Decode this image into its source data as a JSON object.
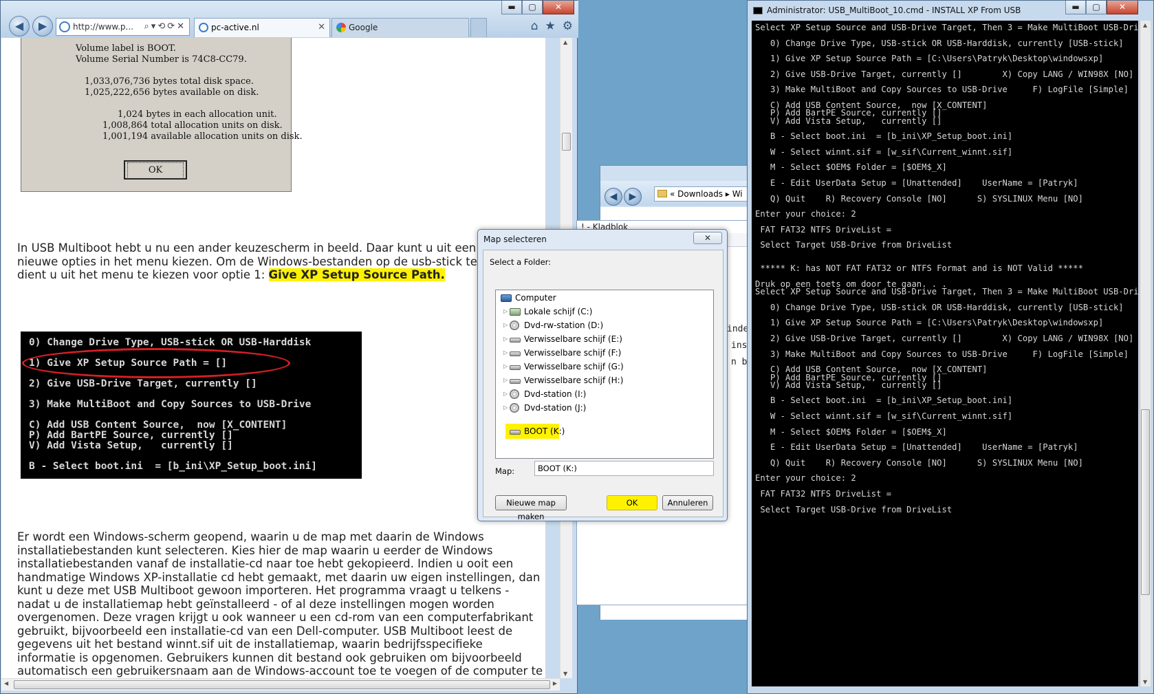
{
  "browser": {
    "address": "http://www.p...",
    "tabs": [
      {
        "label": "pc-active.nl"
      },
      {
        "label": "Google"
      }
    ],
    "window_buttons": {
      "min": "▬",
      "max": "▢",
      "close": "✕"
    },
    "content": {
      "volume_dialog": {
        "lines": [
          "Volume label is BOOT.",
          "Volume Serial Number is 74C8-CC79.",
          "1,033,076,736 bytes total disk space.",
          "1,025,222,656 bytes available on disk.",
          "1,024 bytes in each allocation unit.",
          "1,008,864 total allocation units on disk.",
          "1,001,194 available allocation units on disk."
        ],
        "ok_label": "OK"
      },
      "para1_lines": [
        "In USB Multiboot hebt u nu een ander keuzescherm in beeld. Daar kunt u uit een",
        "nieuwe opties in het menu kiezen. Om de Windows-bestanden op de usb-stick te",
        "dient u uit het menu te kiezen voor optie 1: "
      ],
      "para1_highlight": "Give XP Setup Source Path.",
      "menu_image_lines": [
        "0) Change Drive Type, USB-stick OR USB-Harddisk",
        "1) Give XP Setup Source Path = []",
        "2) Give USB-Drive Target, currently []",
        "3) Make MultiBoot and Copy Sources to USB-Drive",
        "C) Add USB Content Source,  now [X_CONTENT]",
        "P) Add BartPE Source, currently []",
        "V) Add Vista Setup,   currently []",
        "B - Select boot.ini  = [b_ini\\XP_Setup_boot.ini]"
      ],
      "para2_lines": [
        "Er wordt een Windows-scherm geopend, waarin u de map met daarin de Windows",
        "installatiebestanden kunt selecteren. Kies hier de map waarin u eerder de Windows",
        "installatiebestanden vanaf de installatie-cd naar toe hebt gekopieerd. Indien u ooit een",
        "handmatige Windows XP-installatie cd hebt gemaakt, met daarin uw eigen instellingen, dan",
        "kunt u deze met USB Multiboot gewoon importeren. Het programma vraagt u telkens -",
        "nadat u de installatiemap hebt geïnstalleerd - of al deze instellingen mogen worden",
        "overgenomen. Deze vragen krijgt u ook wanneer u een cd-rom van een computerfabrikant",
        "gebruikt, bijvoorbeeld een installatie-cd van een Dell-computer. USB Multiboot leest de",
        "gegevens uit het bestand winnt.sif uit de installatiemap, waarin bedrijfsspecifieke",
        "informatie is opgenomen. Gebruikers kunnen dit bestand ook gebruiken om bijvoorbeeld",
        "automatisch een gebruikersnaam aan de Windows-account toe te voegen of de computer te"
      ]
    }
  },
  "explorer": {
    "breadcrumb": "«  Downloads  ▸  Wi"
  },
  "notepad": {
    "title": "! - Kladblok",
    "fragments": [
      "inde",
      "ins",
      "n bl"
    ]
  },
  "picker": {
    "title": "Map selecteren",
    "prompt": "Select a Folder:",
    "tree": [
      {
        "label": "Computer",
        "icon": "computer-icon",
        "root": true
      },
      {
        "label": "Lokale schijf (C:)",
        "icon": "hard-disk-icon"
      },
      {
        "label": "Dvd-rw-station (D:)",
        "icon": "dvd-icon"
      },
      {
        "label": "Verwisselbare schijf (E:)",
        "icon": "removable-drive-icon"
      },
      {
        "label": "Verwisselbare schijf (F:)",
        "icon": "removable-drive-icon"
      },
      {
        "label": "Verwisselbare schijf (G:)",
        "icon": "removable-drive-icon"
      },
      {
        "label": "Verwisselbare schijf (H:)",
        "icon": "removable-drive-icon"
      },
      {
        "label": "Dvd-station (I:)",
        "icon": "dvd-icon"
      },
      {
        "label": "Dvd-station (J:)",
        "icon": "dvd-icon"
      },
      {
        "label": "BOOT (K:)",
        "icon": "removable-drive-icon",
        "selected": true
      }
    ],
    "map_label": "Map:",
    "map_value": "BOOT (K:)",
    "new_folder_label": "Nieuwe map maken",
    "ok_label": "OK",
    "cancel_label": "Annuleren",
    "highlight_color": "#fff200"
  },
  "console": {
    "title": "Administrator:  USB_MultiBoot_10.cmd - INSTALL XP From USB",
    "lines": [
      "Select XP Setup Source and USB-Drive Target, Then 3 = Make MultiBoot USB-Drive",
      "",
      "   0) Change Drive Type, USB-stick OR USB-Harddisk, currently [USB-stick]",
      "",
      "   1) Give XP Setup Source Path = [C:\\Users\\Patryk\\Desktop\\windowsxp]",
      "",
      "   2) Give USB-Drive Target, currently []        X) Copy LANG / WIN98X [NO]",
      "",
      "   3) Make MultiBoot and Copy Sources to USB-Drive     F) LogFile [Simple]",
      "",
      "   C) Add USB Content Source,  now [X_CONTENT]",
      "   P) Add BartPE Source, currently []",
      "   V) Add Vista Setup,   currently []",
      "",
      "   B - Select boot.ini  = [b_ini\\XP_Setup_boot.ini]",
      "",
      "   W - Select winnt.sif = [w_sif\\Current_winnt.sif]",
      "",
      "   M - Select $OEM$ Folder = [$OEM$_X]",
      "",
      "   E - Edit UserData Setup = [Unattended]    UserName = [Patryk]",
      "",
      "   Q) Quit    R) Recovery Console [NO]      S) SYSLINUX Menu [NO]",
      "",
      "Enter your choice: 2",
      "",
      " FAT FAT32 NTFS DriveList =",
      "",
      " Select Target USB-Drive from DriveList",
      "",
      "",
      " ***** K: has NOT FAT FAT32 or NTFS Format and is NOT Valid *****",
      "",
      "Druk op een toets om door te gaan. . .",
      "Select XP Setup Source and USB-Drive Target, Then 3 = Make MultiBoot USB-Drive",
      "",
      "   0) Change Drive Type, USB-stick OR USB-Harddisk, currently [USB-stick]",
      "",
      "   1) Give XP Setup Source Path = [C:\\Users\\Patryk\\Desktop\\windowsxp]",
      "",
      "   2) Give USB-Drive Target, currently []        X) Copy LANG / WIN98X [NO]",
      "",
      "   3) Make MultiBoot and Copy Sources to USB-Drive     F) LogFile [Simple]",
      "",
      "   C) Add USB Content Source,  now [X_CONTENT]",
      "   P) Add BartPE Source, currently []",
      "   V) Add Vista Setup,   currently []",
      "",
      "   B - Select boot.ini  = [b_ini\\XP_Setup_boot.ini]",
      "",
      "   W - Select winnt.sif = [w_sif\\Current_winnt.sif]",
      "",
      "   M - Select $OEM$ Folder = [$OEM$_X]",
      "",
      "   E - Edit UserData Setup = [Unattended]    UserName = [Patryk]",
      "",
      "   Q) Quit    R) Recovery Console [NO]      S) SYSLINUX Menu [NO]",
      "",
      "Enter your choice: 2",
      "",
      " FAT FAT32 NTFS DriveList =",
      "",
      " Select Target USB-Drive from DriveList"
    ]
  }
}
